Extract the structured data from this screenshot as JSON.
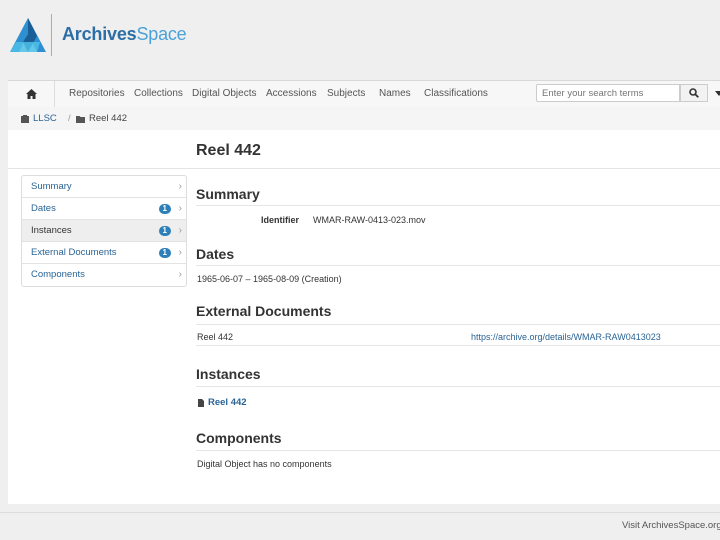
{
  "header": {
    "logo_text_bold": "Archives",
    "logo_text_light": "Space"
  },
  "nav": {
    "home_icon": "home-icon",
    "items": [
      "Repositories",
      "Collections",
      "Digital Objects",
      "Accessions",
      "Subjects",
      "Names",
      "Classifications"
    ],
    "search_placeholder": "Enter your search terms",
    "search_icon": "search-icon"
  },
  "breadcrumb": {
    "items": [
      "LLSC",
      "Reel 442"
    ]
  },
  "record": {
    "title": "Reel 442"
  },
  "sidebar": {
    "items": [
      {
        "label": "Summary",
        "badge": null
      },
      {
        "label": "Dates",
        "badge": "1"
      },
      {
        "label": "Instances",
        "badge": "1"
      },
      {
        "label": "External Documents",
        "badge": "1"
      },
      {
        "label": "Components",
        "badge": null
      }
    ],
    "active_index": 2
  },
  "sections": {
    "summary": {
      "heading": "Summary",
      "identifier_label": "Identifier",
      "identifier_value": "WMAR-RAW-0413-023.mov"
    },
    "dates": {
      "heading": "Dates",
      "value": "1965-06-07 – 1965-08-09 (Creation)"
    },
    "external_documents": {
      "heading": "External Documents",
      "title": "Reel 442",
      "url": "https://archive.org/details/WMAR-RAW0413023"
    },
    "instances": {
      "heading": "Instances",
      "link": "Reel 442"
    },
    "components": {
      "heading": "Components",
      "text": "Digital Object has no components"
    }
  },
  "footer": {
    "text": "Visit ArchivesSpace.org | v"
  },
  "colors": {
    "brand_dark": "#2c6ea5",
    "brand_light": "#4aa2d8",
    "link": "#2a6496",
    "badge": "#2c7fb8"
  }
}
